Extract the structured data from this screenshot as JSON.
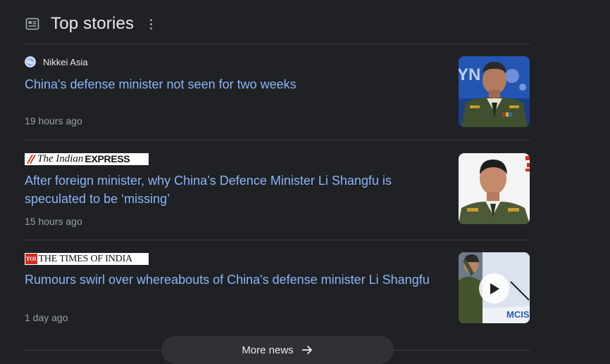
{
  "header": {
    "title": "Top stories"
  },
  "stories": [
    {
      "source": "Nikkei Asia",
      "headline": "China's defense minister not seen for two weeks",
      "time": "19 hours ago"
    },
    {
      "source": "The Indian EXPRESS",
      "source_italic": "The Indian",
      "source_bold": "EXPRESS",
      "headline": "After foreign minister, why China’s Defence Minister Li Shangfu is speculated to be ‘missing’",
      "time": "15 hours ago"
    },
    {
      "source": "TOI THE TIMES OF INDIA",
      "source_badge": "TOI",
      "source_text": "THE TIMES OF INDIA",
      "headline": "Rumours swirl over whereabouts of China's defense minister Li Shangfu",
      "time": "1 day ago"
    }
  ],
  "thumbnail_labels": {
    "story1_backdrop": "YN",
    "story3_backdrop": "MCIS"
  },
  "more_news": {
    "label": "More news"
  },
  "colors": {
    "background": "#202124",
    "link": "#8ab4f8",
    "text_primary": "#e8eaed",
    "text_secondary": "#9aa0a6",
    "divider": "#3c4043",
    "toi_red": "#d52b1e"
  },
  "icons": {
    "header": "newspaper-icon",
    "menu": "more-vert-icon",
    "more_news": "arrow-right-icon",
    "video": "play-icon"
  }
}
